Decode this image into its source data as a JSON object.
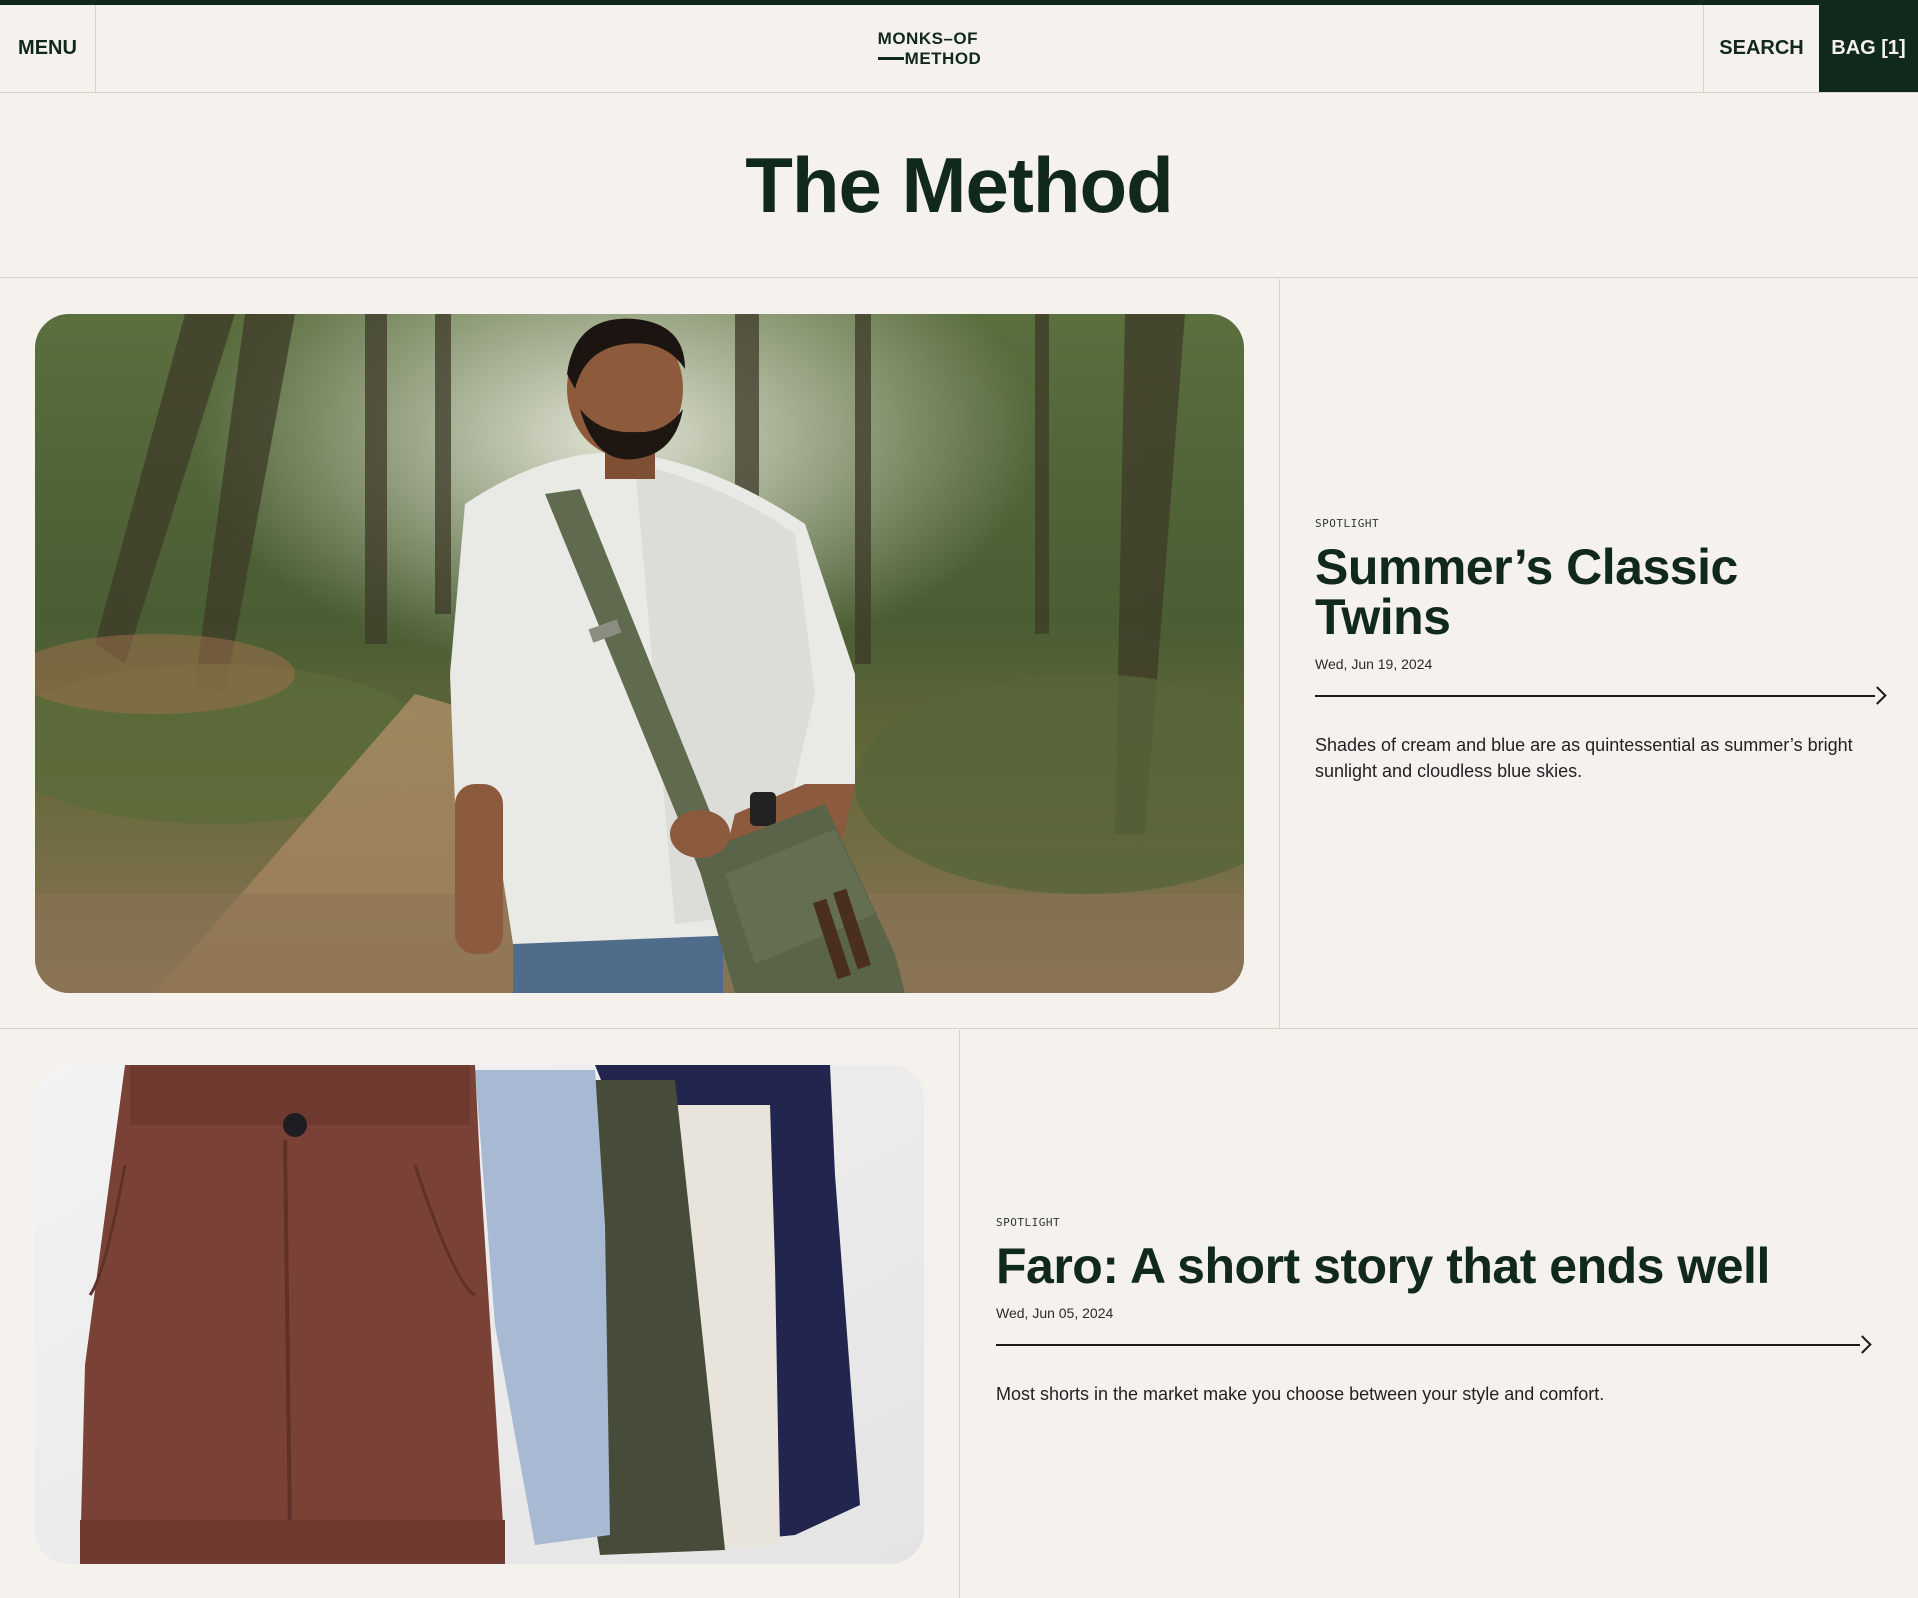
{
  "header": {
    "menu_label": "MENU",
    "logo_line1": "MONKS–OF",
    "logo_line2": "METHOD",
    "search_label": "SEARCH",
    "bag_label": "BAG [1]"
  },
  "page": {
    "title": "The Method"
  },
  "articles": [
    {
      "kicker": "SPOTLIGHT",
      "headline": "Summer’s Classic Twins",
      "date": "Wed, Jun 19, 2024",
      "excerpt": "Shades of cream and blue are as quintessential as summer’s bright sunlight and cloudless blue skies."
    },
    {
      "kicker": "SPOTLIGHT",
      "headline": "Faro: A short story that ends well",
      "date": "Wed, Jun 05, 2024",
      "excerpt": "Most shorts in the market make you choose between your style and comfort."
    }
  ],
  "colors": {
    "brand": "#11291a",
    "background": "#f5f1ed",
    "divider": "#d8d2cb"
  },
  "icons": {
    "read_more": "arrow-right-icon"
  }
}
